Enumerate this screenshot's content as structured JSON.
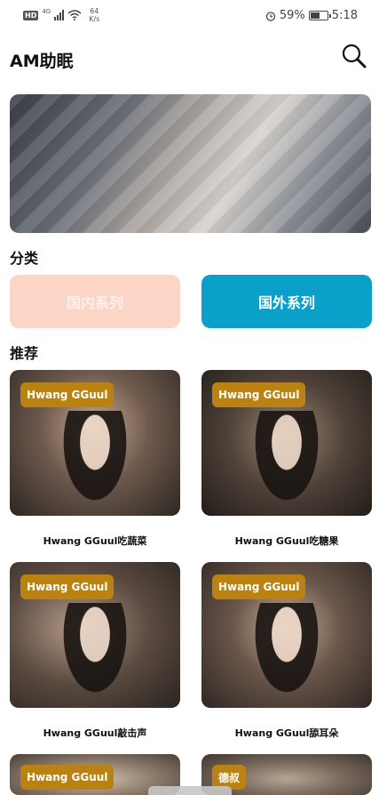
{
  "status_bar": {
    "hd": "HD",
    "network": "4G",
    "speed_value": "64",
    "speed_unit": "K/s",
    "battery_text": "59%",
    "battery_level": 0.59,
    "time": "5:18"
  },
  "header": {
    "title": "AM助眠",
    "search_icon": "search-icon"
  },
  "sections": {
    "category_title": "分类",
    "recommend_title": "推荐"
  },
  "categories": [
    {
      "label": "国内系列",
      "color": "#fbd6c7"
    },
    {
      "label": "国外系列",
      "color": "#0aa0c9"
    }
  ],
  "tag_color": "#b98212",
  "videos": [
    {
      "tag": "Hwang GGuul",
      "title": "Hwang GGuul吃蔬菜"
    },
    {
      "tag": "Hwang GGuul",
      "title": "Hwang GGuul吃糖果"
    },
    {
      "tag": "Hwang GGuul",
      "title": "Hwang GGuul敲击声"
    },
    {
      "tag": "Hwang GGuul",
      "title": "Hwang GGuul舔耳朵"
    },
    {
      "tag": "Hwang GGuul",
      "title": ""
    },
    {
      "tag": "德叔",
      "title": ""
    }
  ]
}
